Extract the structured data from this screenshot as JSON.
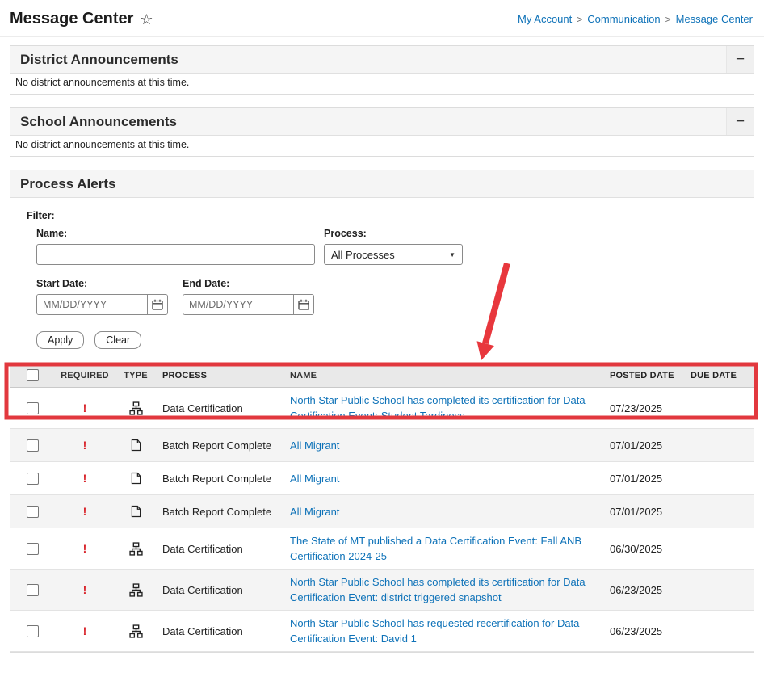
{
  "header": {
    "title": "Message Center",
    "star_icon": "☆",
    "breadcrumb": {
      "separator": ">",
      "items": [
        "My Account",
        "Communication",
        "Message Center"
      ]
    }
  },
  "district_panel": {
    "title": "District Announcements",
    "collapse_label": "−",
    "empty_text": "No district announcements at this time."
  },
  "school_panel": {
    "title": "School Announcements",
    "collapse_label": "−",
    "empty_text": "No district announcements at this time."
  },
  "process_alerts": {
    "title": "Process Alerts",
    "filter": {
      "label": "Filter:",
      "name_label": "Name:",
      "name_value": "",
      "process_label": "Process:",
      "process_value": "All Processes",
      "caret": "▼",
      "start_date_label": "Start Date:",
      "end_date_label": "End Date:",
      "date_placeholder": "MM/DD/YYYY",
      "apply_label": "Apply",
      "clear_label": "Clear"
    },
    "table": {
      "headers": {
        "required": "REQUIRED",
        "type": "TYPE",
        "process": "PROCESS",
        "name": "NAME",
        "posted": "POSTED DATE",
        "due": "DUE DATE"
      },
      "rows": [
        {
          "required": "!",
          "type": "data-certification",
          "process": "Data Certification",
          "name": "North Star Public School has completed its certification for Data Certification Event: Student Tardiness",
          "posted": "07/23/2025",
          "due": "",
          "highlighted": true
        },
        {
          "required": "!",
          "type": "batch-report",
          "process": "Batch Report Complete",
          "name": "All Migrant",
          "posted": "07/01/2025",
          "due": ""
        },
        {
          "required": "!",
          "type": "batch-report",
          "process": "Batch Report Complete",
          "name": "All Migrant",
          "posted": "07/01/2025",
          "due": ""
        },
        {
          "required": "!",
          "type": "batch-report",
          "process": "Batch Report Complete",
          "name": "All Migrant",
          "posted": "07/01/2025",
          "due": ""
        },
        {
          "required": "!",
          "type": "data-certification",
          "process": "Data Certification",
          "name": "The State of MT published a Data Certification Event: Fall ANB Certification 2024-25",
          "posted": "06/30/2025",
          "due": ""
        },
        {
          "required": "!",
          "type": "data-certification",
          "process": "Data Certification",
          "name": "North Star Public School has completed its certification for Data Certification Event: district triggered snapshot",
          "posted": "06/23/2025",
          "due": ""
        },
        {
          "required": "!",
          "type": "data-certification",
          "process": "Data Certification",
          "name": "North Star Public School has requested recertification for Data Certification Event: David 1",
          "posted": "06/23/2025",
          "due": ""
        }
      ]
    }
  },
  "colors": {
    "annotation_red": "#e2383e",
    "alert_red": "#d8232a",
    "link_blue": "#0e72b8"
  }
}
